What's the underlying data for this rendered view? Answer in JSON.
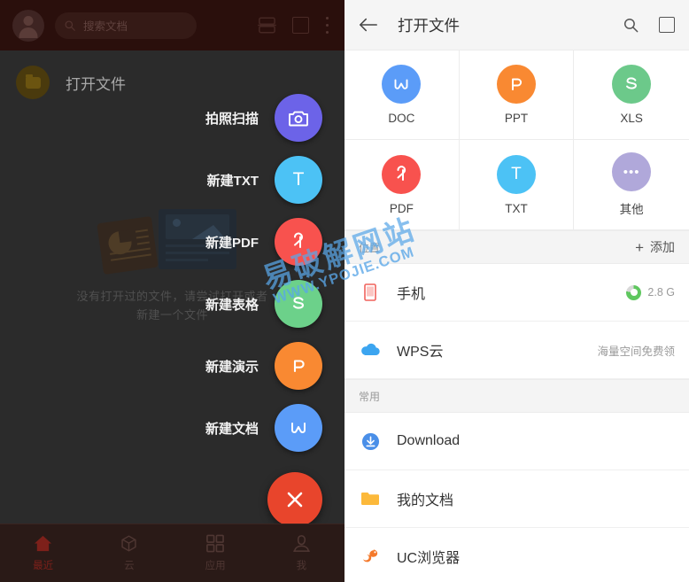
{
  "left": {
    "search": {
      "placeholder": "搜索文档",
      "icon": "search-icon"
    },
    "topicons": {
      "split": "split-screen-icon",
      "window": "multi-window-icon",
      "more": "more-menu-icon"
    },
    "open_header": {
      "label": "打开文件",
      "icon": "folder-icon"
    },
    "empty_state": {
      "line1": "没有打开过的文件，请尝试打开或者",
      "line2": "新建一个文件"
    },
    "actions": [
      {
        "label": "拍照扫描",
        "icon": "camera-icon",
        "color": "#6c63e8"
      },
      {
        "label": "新建TXT",
        "icon": "txt-icon",
        "color": "#4cc2f5",
        "glyph": "T"
      },
      {
        "label": "新建PDF",
        "icon": "pdf-icon",
        "color": "#f8524e",
        "glyph": "P"
      },
      {
        "label": "新建表格",
        "icon": "spreadsheet-icon",
        "color": "#6cd18a",
        "glyph": "S"
      },
      {
        "label": "新建演示",
        "icon": "presentation-icon",
        "color": "#f98932",
        "glyph": "P"
      },
      {
        "label": "新建文档",
        "icon": "document-icon",
        "color": "#5b9cf8",
        "glyph": "W"
      }
    ],
    "close_button": {
      "label": "关闭",
      "icon": "close-icon",
      "color": "#e8452c"
    },
    "tabs": [
      {
        "label": "最近",
        "icon": "home-icon",
        "active": true
      },
      {
        "label": "云",
        "icon": "cloud-cube-icon",
        "active": false
      },
      {
        "label": "应用",
        "icon": "apps-grid-icon",
        "active": false
      },
      {
        "label": "我",
        "icon": "person-icon",
        "active": false
      }
    ]
  },
  "right": {
    "header": {
      "title": "打开文件",
      "back_icon": "back-arrow-icon",
      "search_icon": "search-icon",
      "window_icon": "multi-window-icon"
    },
    "file_types": [
      {
        "label": "DOC",
        "glyph": "W",
        "color": "#5b9cf8",
        "icon": "doc-icon"
      },
      {
        "label": "PPT",
        "glyph": "P",
        "color": "#f98932",
        "icon": "ppt-icon"
      },
      {
        "label": "XLS",
        "glyph": "S",
        "color": "#6cc98a",
        "icon": "xls-icon"
      },
      {
        "label": "PDF",
        "glyph": "P",
        "color": "#f8524e",
        "icon": "pdf-icon"
      },
      {
        "label": "TXT",
        "glyph": "T",
        "color": "#4cc2f5",
        "icon": "txt-icon"
      },
      {
        "label": "其他",
        "glyph": "•••",
        "color": "#b0a8da",
        "icon": "other-icon"
      }
    ],
    "locations_section": {
      "label": "位置",
      "action_label": "添加",
      "action_icon": "plus-icon"
    },
    "locations": [
      {
        "label": "手机",
        "icon": "phone-icon",
        "meta": "2.8 G",
        "has_donut": true
      },
      {
        "label": "WPS云",
        "icon": "cloud-icon",
        "meta": "海量空间免费领",
        "has_donut": false
      }
    ],
    "common_section": {
      "label": "常用"
    },
    "common": [
      {
        "label": "Download",
        "icon": "download-icon"
      },
      {
        "label": "我的文档",
        "icon": "folder-icon"
      },
      {
        "label": "UC浏览器",
        "icon": "uc-browser-icon"
      }
    ]
  },
  "watermark": {
    "cn": "易破解网站",
    "url": "WWW.YPOJIE.COM",
    "color": "#5aa7e8"
  }
}
